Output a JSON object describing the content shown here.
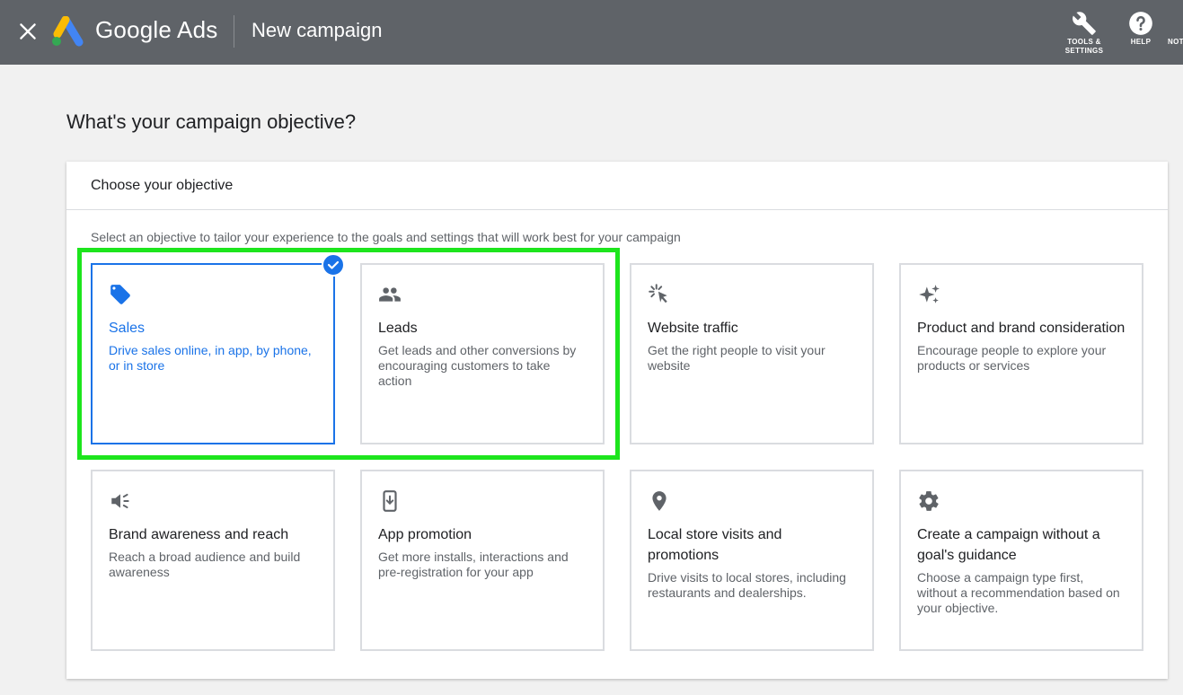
{
  "header": {
    "brand": "Google Ads",
    "page_title": "New campaign",
    "tools": [
      {
        "label_line1": "TOOLS &",
        "label_line2": "SETTINGS",
        "icon": "wrench-icon"
      },
      {
        "label_line1": "HELP",
        "label_line2": "",
        "icon": "help-icon"
      },
      {
        "label_line1": "NOT",
        "label_line2": "",
        "icon": "notifications-icon"
      }
    ]
  },
  "main": {
    "heading": "What's your campaign objective?",
    "card_title": "Choose your objective",
    "subtitle": "Select an objective to tailor your experience to the goals and settings that will work best for your campaign",
    "selected_objective": "Sales",
    "objectives": [
      {
        "title": "Sales",
        "desc": "Drive sales online, in app, by phone, or in store",
        "icon": "tag-icon"
      },
      {
        "title": "Leads",
        "desc": "Get leads and other conversions by encouraging customers to take action",
        "icon": "people-icon"
      },
      {
        "title": "Website traffic",
        "desc": "Get the right people to visit your website",
        "icon": "cursor-click-icon"
      },
      {
        "title": "Product and brand consideration",
        "desc": "Encourage people to explore your products or services",
        "icon": "sparkle-icon"
      },
      {
        "title": "Brand awareness and reach",
        "desc": "Reach a broad audience and build awareness",
        "icon": "megaphone-icon"
      },
      {
        "title": "App promotion",
        "desc": "Get more installs, interactions and pre-registration for your app",
        "icon": "phone-download-icon"
      },
      {
        "title": "Local store visits and promotions",
        "desc": "Drive visits to local stores, including restaurants and dealerships.",
        "icon": "location-pin-icon"
      },
      {
        "title": "Create a campaign without a goal's guidance",
        "desc": "Choose a campaign type first, without a recommendation based on your objective.",
        "icon": "gear-icon"
      }
    ]
  },
  "colors": {
    "topbar": "#5f6368",
    "accent": "#1a73e8",
    "highlight": "#1de51d"
  }
}
